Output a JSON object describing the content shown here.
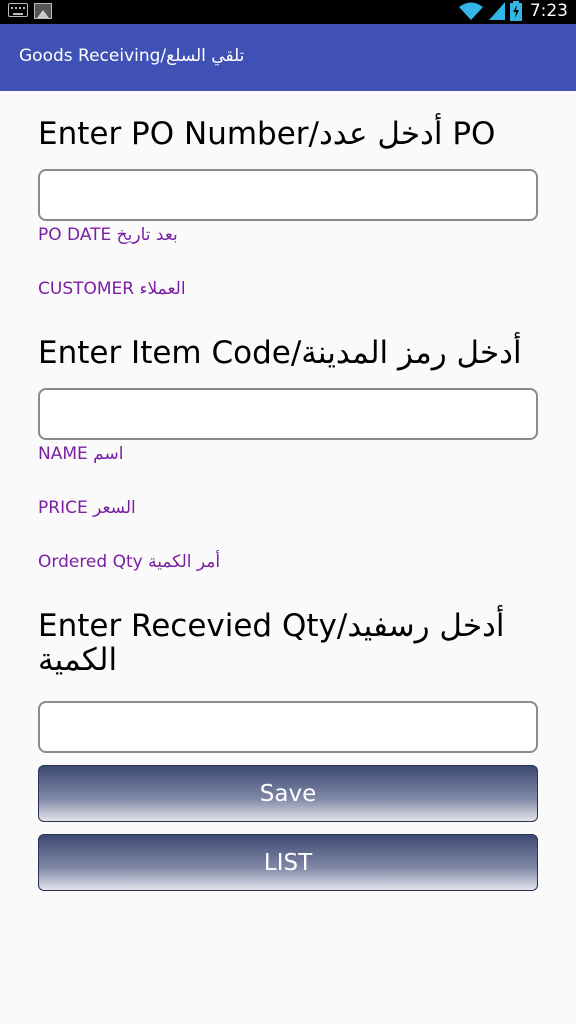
{
  "status_bar": {
    "time": "7:23"
  },
  "app_bar": {
    "title": "Goods Receiving/تلقي السلع"
  },
  "po_section": {
    "heading": "Enter PO Number/أدخل عدد PO",
    "po_date_label": "PO DATE بعد تاريخ",
    "customer_label": "CUSTOMER  العملاء"
  },
  "item_section": {
    "heading": "Enter Item Code/أدخل رمز المدينة",
    "name_label": "NAME اسم",
    "price_label": "PRICE السعر",
    "ordered_qty_label": "Ordered Qty أمر الكمية"
  },
  "qty_section": {
    "heading": "Enter Recevied Qty/أدخل رسفيد الكمية"
  },
  "buttons": {
    "save": "Save",
    "list": "LIST"
  }
}
